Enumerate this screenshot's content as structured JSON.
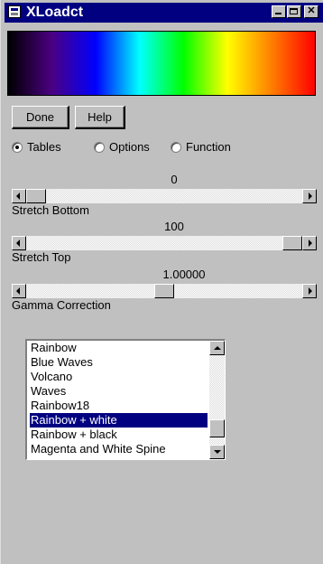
{
  "window": {
    "title": "XLoadct",
    "minimize_icon": "minimize-icon",
    "maximize_icon": "maximize-icon",
    "close_label": "✕"
  },
  "color_table_preview": {
    "colors": [
      "#000000",
      "#4b0082",
      "#0000ff",
      "#00ffff",
      "#00ff00",
      "#ffff00",
      "#ff8000",
      "#ff0000"
    ]
  },
  "buttons": {
    "done": "Done",
    "help": "Help"
  },
  "modes": {
    "selected": "Tables",
    "items": [
      {
        "label": "Tables"
      },
      {
        "label": "Options"
      },
      {
        "label": "Function"
      }
    ]
  },
  "sliders": {
    "stretch_bottom": {
      "value": "0",
      "caption": "Stretch Bottom",
      "position": 0.0
    },
    "stretch_top": {
      "value": "100",
      "caption": "Stretch Top",
      "position": 1.0
    },
    "gamma": {
      "value": "1.00000",
      "caption": "Gamma Correction",
      "position": 0.5
    }
  },
  "color_tables": {
    "items": [
      {
        "label": "Rainbow"
      },
      {
        "label": "Blue Waves"
      },
      {
        "label": "Volcano"
      },
      {
        "label": "Waves"
      },
      {
        "label": "Rainbow18"
      },
      {
        "label": "Rainbow + white"
      },
      {
        "label": "Rainbow + black"
      },
      {
        "label": "Magenta and White Spine"
      }
    ],
    "selected": "Rainbow + white",
    "scroll_position": 0.9
  }
}
